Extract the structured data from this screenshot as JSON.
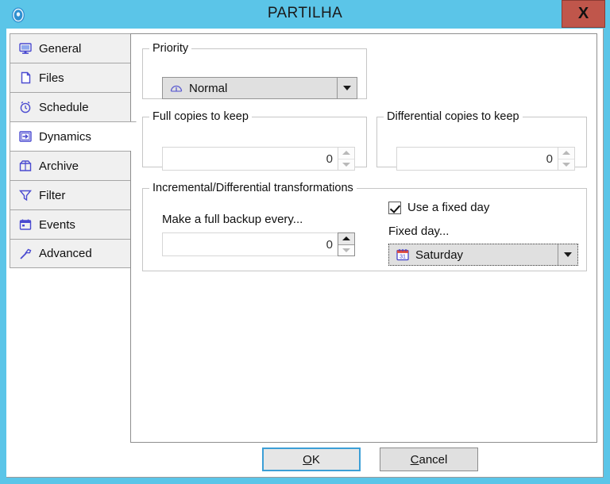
{
  "window": {
    "title": "PARTILHA",
    "icon": "disc-icon",
    "close_label": "X",
    "title_bar_color": "#5bc5e8",
    "close_button_color": "#c0564b"
  },
  "sidebar": {
    "items": [
      {
        "label": "General",
        "icon": "monitor-icon",
        "selected": false
      },
      {
        "label": "Files",
        "icon": "file-icon",
        "selected": false
      },
      {
        "label": "Schedule",
        "icon": "alarm-clock-icon",
        "selected": false
      },
      {
        "label": "Dynamics",
        "icon": "arrow-in-box-icon",
        "selected": true
      },
      {
        "label": "Archive",
        "icon": "archive-box-icon",
        "selected": false
      },
      {
        "label": "Filter",
        "icon": "funnel-icon",
        "selected": false
      },
      {
        "label": "Events",
        "icon": "calendar-icon",
        "selected": false
      },
      {
        "label": "Advanced",
        "icon": "wrench-icon",
        "selected": false
      }
    ]
  },
  "priority": {
    "legend": "Priority",
    "value": "Normal",
    "icon": "gauge-icon"
  },
  "full_copies": {
    "legend": "Full copies to keep",
    "value": "0"
  },
  "differential_copies": {
    "legend": "Differential copies to keep",
    "value": "0"
  },
  "transformations": {
    "legend": "Incremental/Differential transformations",
    "full_backup_every_label": "Make a full backup every...",
    "full_backup_every_value": "0",
    "use_fixed_day_label": "Use a fixed day",
    "use_fixed_day_checked": true,
    "fixed_day_label": "Fixed day...",
    "fixed_day_value": "Saturday",
    "fixed_day_icon": "calendar-31-icon"
  },
  "buttons": {
    "ok_mnemonic": "O",
    "ok_rest": "K",
    "cancel_mnemonic": "C",
    "cancel_rest": "ancel"
  }
}
